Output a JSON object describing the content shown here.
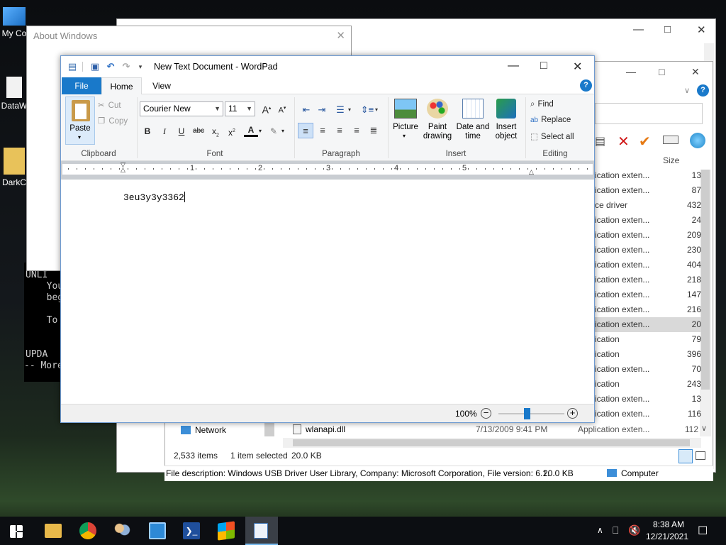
{
  "desktop": {
    "icons": [
      {
        "label": "My Co"
      },
      {
        "label": "DataW"
      },
      {
        "label": "DarkC"
      }
    ]
  },
  "terminal": {
    "lines": [
      "UNLI",
      "  You",
      "  beg",
      "",
      "  To",
      "",
      "",
      "UPDA",
      "-- More"
    ]
  },
  "about_window": {
    "title": "About Windows"
  },
  "explorer": {
    "size_header": "Size",
    "nav_network": "Network",
    "visible_file": {
      "name": "wlanapi.dll",
      "date": "7/13/2009 9:41 PM",
      "type": "Application exten...",
      "size": "112"
    },
    "rows": [
      {
        "type": "ication exten...",
        "size": "13"
      },
      {
        "type": "ication exten...",
        "size": "87"
      },
      {
        "type": "ce driver",
        "size": "432"
      },
      {
        "type": "ication exten...",
        "size": "24"
      },
      {
        "type": "ication exten...",
        "size": "209"
      },
      {
        "type": "ication exten...",
        "size": "230"
      },
      {
        "type": "ication exten...",
        "size": "404"
      },
      {
        "type": "ication exten...",
        "size": "218"
      },
      {
        "type": "ication exten...",
        "size": "147"
      },
      {
        "type": "ication exten...",
        "size": "216"
      },
      {
        "type": "ication exten...",
        "size": "20"
      },
      {
        "type": "ication",
        "size": "79"
      },
      {
        "type": "ication",
        "size": "396"
      },
      {
        "type": "ication exten...",
        "size": "70"
      },
      {
        "type": "ication",
        "size": "243"
      },
      {
        "type": "ication exten...",
        "size": "13"
      },
      {
        "type": "ication exten...",
        "size": "116"
      }
    ],
    "selected_row_index": 10,
    "status_items": "2,533 items",
    "status_selected": "1 item selected",
    "status_size": "20.0 KB",
    "details_bar": "File description: Windows USB Driver User Library, Company: Microsoft Corporation, File version: 6.1.",
    "details_size": "20.0 KB",
    "details_location": "Computer"
  },
  "wordpad": {
    "title": "New Text Document - WordPad",
    "tabs": {
      "file": "File",
      "home": "Home",
      "view": "View"
    },
    "clipboard": {
      "paste": "Paste",
      "cut": "Cut",
      "copy": "Copy",
      "group": "Clipboard"
    },
    "font": {
      "family": "Courier New",
      "size": "11",
      "group": "Font"
    },
    "paragraph": {
      "group": "Paragraph"
    },
    "insert": {
      "picture": "Picture",
      "paint_1": "Paint",
      "paint_2": "drawing",
      "datetime_1": "Date and",
      "datetime_2": "time",
      "object_1": "Insert",
      "object_2": "object",
      "group": "Insert"
    },
    "editing": {
      "find": "Find",
      "replace": "Replace",
      "select_all": "Select all",
      "group": "Editing"
    },
    "ruler_numbers": [
      "1",
      "2",
      "3",
      "4",
      "5"
    ],
    "document_text": "3eu3y3y3362",
    "zoom": "100%",
    "zoom_level_fraction": 0.43,
    "colors": {
      "accent": "#1979ca"
    }
  },
  "taskbar": {
    "apps": [
      "start-icon",
      "file-explorer-icon",
      "chrome-icon",
      "users-icon",
      "control-panel-icon",
      "powershell-icon",
      "windows-flag-icon",
      "wordpad-icon"
    ],
    "time": "8:38 AM",
    "date": "12/21/2021"
  }
}
